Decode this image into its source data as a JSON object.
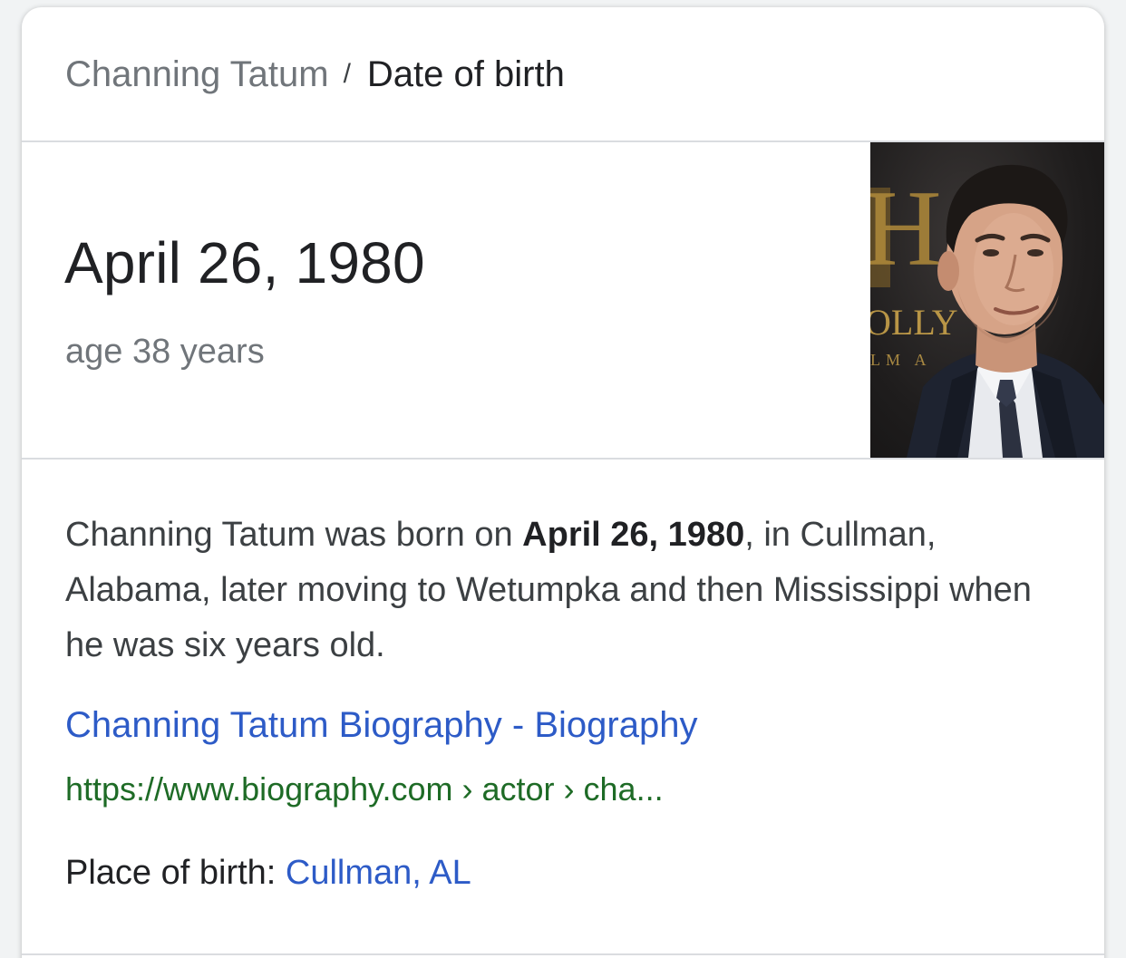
{
  "breadcrumb": {
    "parent": "Channing Tatum",
    "separator": "/",
    "current": "Date of birth"
  },
  "answer": {
    "date": "April 26, 1980",
    "age": "age 38 years"
  },
  "description": {
    "before": "Channing Tatum was born on ",
    "bold": "April 26, 1980",
    "after": ", in Cullman, Alabama, later moving to Wetumpka and then Mississippi when he was six years old."
  },
  "source": {
    "title": "Channing Tatum Biography - Biography",
    "url": "https://www.biography.com › actor › cha..."
  },
  "place_of_birth": {
    "label": "Place of birth: ",
    "value": "Cullman, AL"
  },
  "thumbnail": {
    "backdrop_text_1": "H",
    "backdrop_text_2": "OLLY",
    "backdrop_text_3": "LM A"
  },
  "colors": {
    "link": "#2d5bc7",
    "url": "#1e6b26",
    "muted": "#70757a",
    "text": "#202124"
  }
}
